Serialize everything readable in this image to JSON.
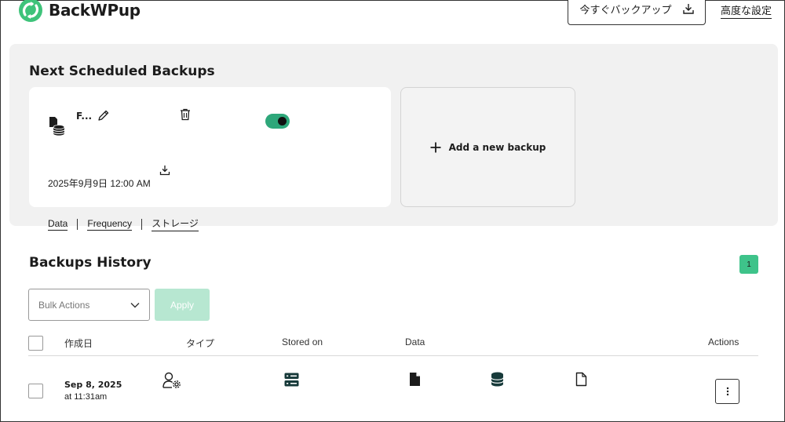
{
  "header": {
    "brand": "BackWPup",
    "backup_now_label": "今すぐバックアップ",
    "advanced_settings_label": "高度な設定"
  },
  "scheduled": {
    "title": "Next Scheduled Backups",
    "card": {
      "name": "F...",
      "date": "2025年9月9日 12:00 AM",
      "enabled": true
    },
    "add_label": "Add a new backup",
    "tabs": [
      {
        "label": "Data"
      },
      {
        "label": "Frequency"
      },
      {
        "label": "ストレージ"
      }
    ]
  },
  "history": {
    "title": "Backups History",
    "page": "1",
    "bulk_actions_placeholder": "Bulk Actions",
    "apply_label": "Apply",
    "columns": {
      "created": "作成日",
      "type": "タイプ",
      "stored_on": "Stored on",
      "data": "Data",
      "actions": "Actions"
    },
    "rows": [
      {
        "date": "Sep 8, 2025",
        "time": "at 11:31am",
        "type_icon": "user-gear-icon",
        "stored_icon": "server-icon",
        "data_icons": [
          "file-filled-icon",
          "database-icon",
          "file-outline-icon"
        ]
      }
    ]
  },
  "colors": {
    "accent": "#3ec38a",
    "toggle_on": "#2ea77a",
    "apply_disabled": "#b7e7d1",
    "panel_bg": "#f1f1f1"
  }
}
